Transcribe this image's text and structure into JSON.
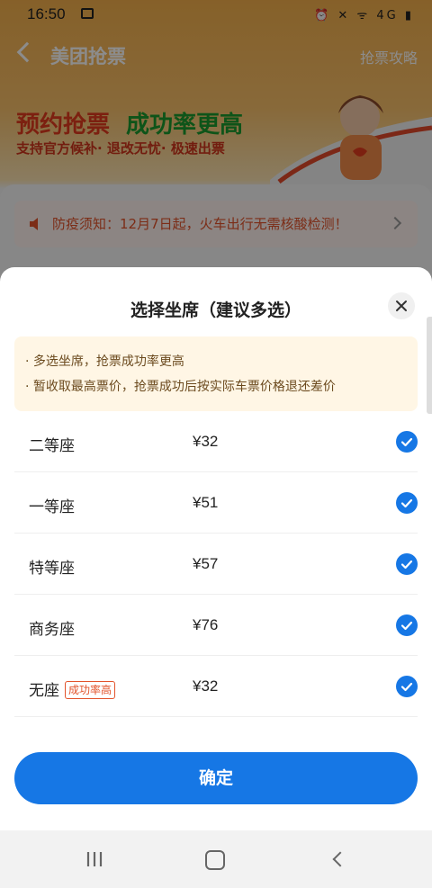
{
  "status_bar": {
    "time": "16:50",
    "right_icons": "⏰ ✕ ᯤ 4G ▮"
  },
  "header": {
    "title": "美团抢票",
    "guide_link": "抢票攻略"
  },
  "banner": {
    "title_part1": "预约抢票",
    "title_part2": "成功率更高",
    "subtitle": "支持官方候补· 退改无忧· 极速出票"
  },
  "notice": {
    "text": "防疫须知：12月7日起，火车出行无需核酸检测！"
  },
  "sheet": {
    "title": "选择坐席（建议多选）",
    "tips": [
      "· 多选坐席，抢票成功率更高",
      "· 暂收取最高票价，抢票成功后按实际车票价格退还差价"
    ],
    "seats": [
      {
        "name": "二等座",
        "price": "¥32",
        "badge": "",
        "checked": true
      },
      {
        "name": "一等座",
        "price": "¥51",
        "badge": "",
        "checked": true
      },
      {
        "name": "特等座",
        "price": "¥57",
        "badge": "",
        "checked": true
      },
      {
        "name": "商务座",
        "price": "¥76",
        "badge": "",
        "checked": true
      },
      {
        "name": "无座",
        "price": "¥32",
        "badge": "成功率高",
        "checked": true
      }
    ],
    "confirm_label": "确定"
  },
  "colors": {
    "accent": "#1677e5",
    "warning": "#e2532b",
    "tips_bg": "#fff6e5"
  }
}
